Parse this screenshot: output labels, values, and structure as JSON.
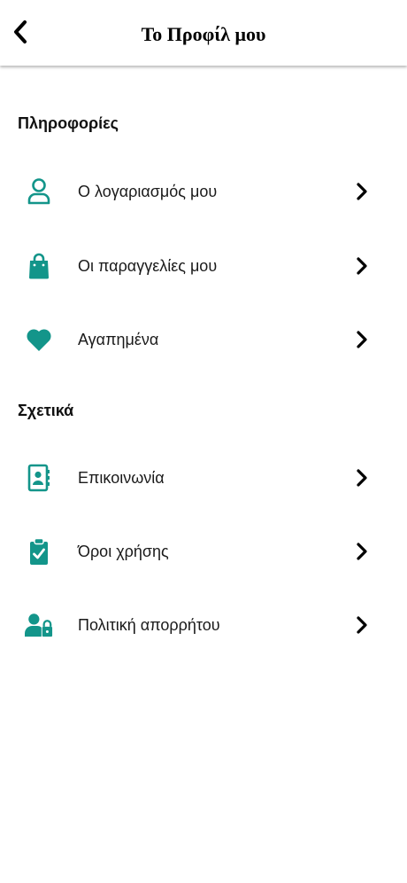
{
  "header": {
    "title": "Το Προφίλ μου",
    "back_icon": "chevron-left-icon"
  },
  "colors": {
    "accent": "#13958a",
    "text": "#111111",
    "background": "#ffffff"
  },
  "sections": [
    {
      "heading": "Πληροφορίες",
      "items": [
        {
          "label": "Ο λογαριασμός μου",
          "icon": "user-outline-icon"
        },
        {
          "label": "Οι παραγγελίες μου",
          "icon": "shopping-bag-icon"
        },
        {
          "label": "Αγαπημένα",
          "icon": "heart-icon"
        }
      ]
    },
    {
      "heading": "Σχετικά",
      "items": [
        {
          "label": "Επικοινωνία",
          "icon": "contact-book-icon"
        },
        {
          "label": "Όροι χρήσης",
          "icon": "clipboard-check-icon"
        },
        {
          "label": "Πολιτική απορρήτου",
          "icon": "user-lock-icon"
        }
      ]
    }
  ]
}
